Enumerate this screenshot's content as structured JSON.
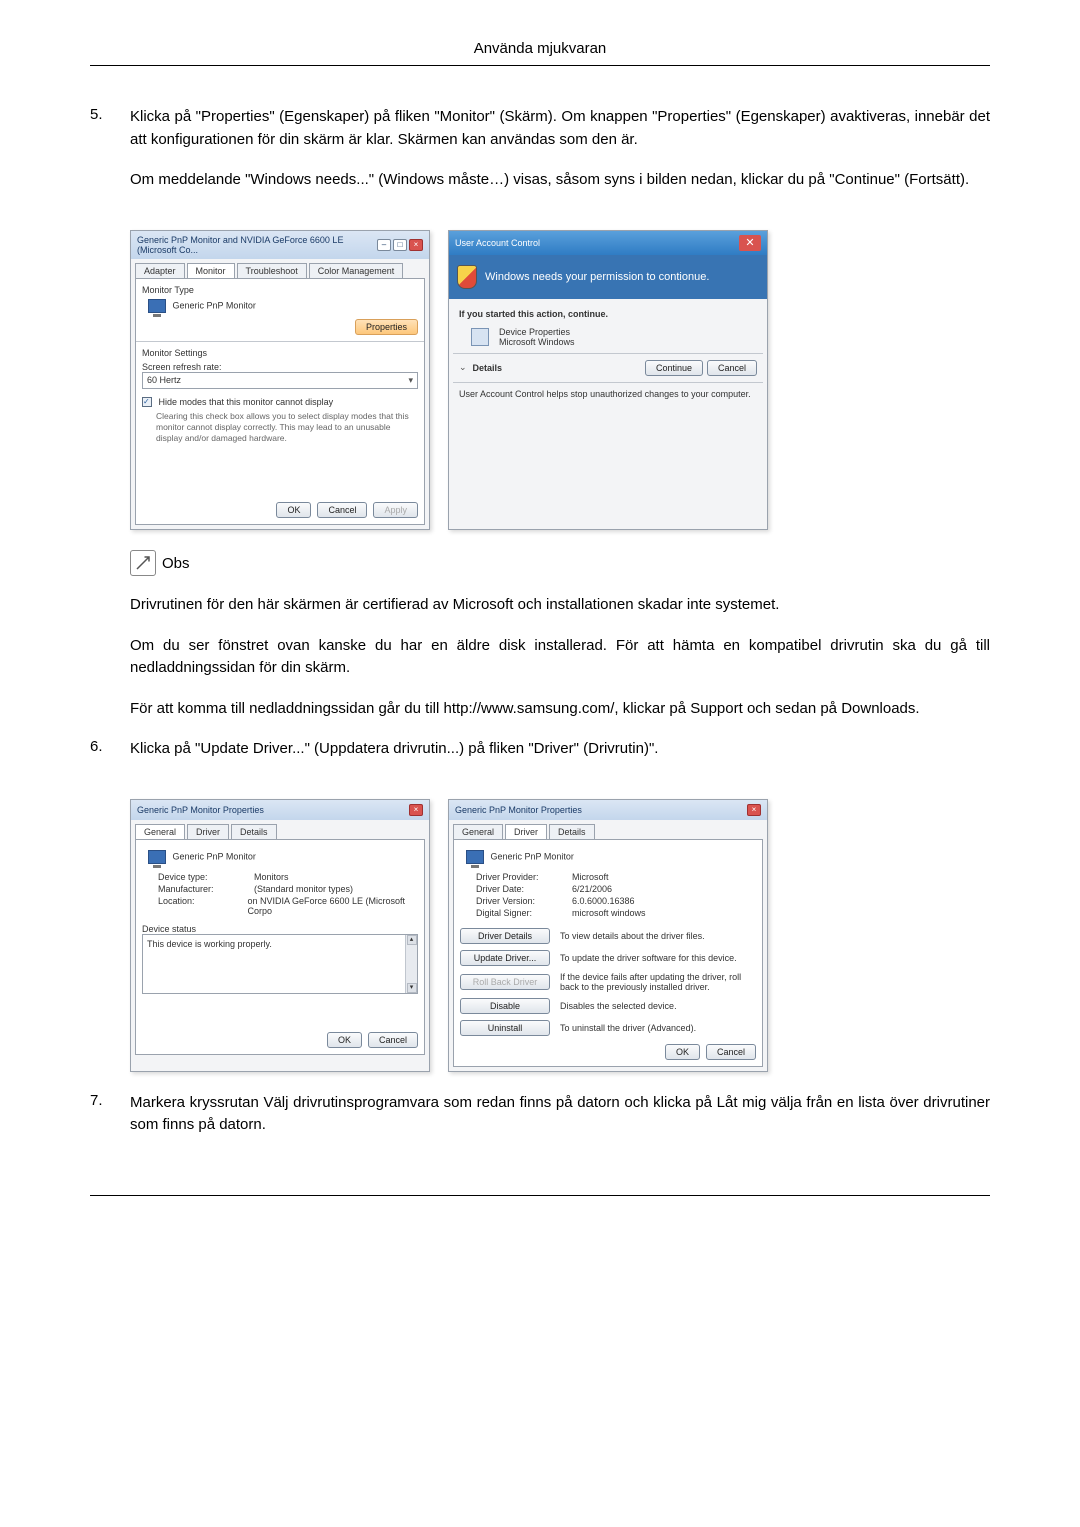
{
  "header": "Använda mjukvaran",
  "step5": {
    "num": "5.",
    "p1": "Klicka på \"Properties\" (Egenskaper) på fliken \"Monitor\" (Skärm). Om knappen \"Properties\" (Egenskaper) avaktiveras, innebär det att konfigurationen för din skärm är klar. Skärmen kan användas som den är.",
    "p2": "Om meddelande \"Windows needs...\" (Windows måste…) visas, såsom syns i bilden nedan, klickar du på \"Continue\" (Fortsätt)."
  },
  "shot1": {
    "title": "Generic PnP Monitor and NVIDIA GeForce 6600 LE (Microsoft Co...",
    "tabs": {
      "adapter": "Adapter",
      "monitor": "Monitor",
      "troubleshoot": "Troubleshoot",
      "color": "Color Management"
    },
    "monitorTypeLabel": "Monitor Type",
    "monitorName": "Generic PnP Monitor",
    "propertiesBtn": "Properties",
    "monitorSettingsLabel": "Monitor Settings",
    "refreshLabel": "Screen refresh rate:",
    "refreshValue": "60 Hertz",
    "hideCheck": "Hide modes that this monitor cannot display",
    "hideDesc": "Clearing this check box allows you to select display modes that this monitor cannot display correctly. This may lead to an unusable display and/or damaged hardware.",
    "ok": "OK",
    "cancel": "Cancel",
    "apply": "Apply"
  },
  "uac": {
    "title": "User Account Control",
    "headline": "Windows needs your permission to contionue.",
    "started": "If you started this action, continue.",
    "devProps": "Device Properties",
    "msWin": "Microsoft Windows",
    "details": "Details",
    "continue": "Continue",
    "cancel": "Cancel",
    "footer": "User Account Control helps stop unauthorized changes to your computer."
  },
  "obs": {
    "label": "Obs",
    "p1": "Drivrutinen för den här skärmen är certifierad av Microsoft och installationen skadar inte systemet.",
    "p2": "Om du ser fönstret ovan kanske du har en äldre disk installerad. För att hämta en kompatibel drivrutin ska du gå till nedladdningssidan för din skärm.",
    "p3": "För att komma till nedladdningssidan går du till http://www.samsung.com/, klickar på Support och sedan på Downloads."
  },
  "step6": {
    "num": "6.",
    "p1": "Klicka på \"Update Driver...\" (Uppdatera drivrutin...) på fliken \"Driver\" (Drivrutin)\"."
  },
  "shotGen": {
    "title": "Generic PnP Monitor Properties",
    "tabs": {
      "general": "General",
      "driver": "Driver",
      "details": "Details"
    },
    "monitorName": "Generic PnP Monitor",
    "devType": {
      "k": "Device type:",
      "v": "Monitors"
    },
    "manu": {
      "k": "Manufacturer:",
      "v": "(Standard monitor types)"
    },
    "loc": {
      "k": "Location:",
      "v": "on NVIDIA GeForce 6600 LE (Microsoft Corpo"
    },
    "statusLabel": "Device status",
    "statusText": "This device is working properly.",
    "ok": "OK",
    "cancel": "Cancel"
  },
  "shotDrv": {
    "title": "Generic PnP Monitor Properties",
    "tabs": {
      "general": "General",
      "driver": "Driver",
      "details": "Details"
    },
    "monitorName": "Generic PnP Monitor",
    "provider": {
      "k": "Driver Provider:",
      "v": "Microsoft"
    },
    "date": {
      "k": "Driver Date:",
      "v": "6/21/2006"
    },
    "version": {
      "k": "Driver Version:",
      "v": "6.0.6000.16386"
    },
    "signer": {
      "k": "Digital Signer:",
      "v": "microsoft windows"
    },
    "btnDetails": "Driver Details",
    "btnDetailsDesc": "To view details about the driver files.",
    "btnUpdate": "Update Driver...",
    "btnUpdateDesc": "To update the driver software for this device.",
    "btnRoll": "Roll Back Driver",
    "btnRollDesc": "If the device fails after updating the driver, roll back to the previously installed driver.",
    "btnDisable": "Disable",
    "btnDisableDesc": "Disables the selected device.",
    "btnUninstall": "Uninstall",
    "btnUninstallDesc": "To uninstall the driver (Advanced).",
    "ok": "OK",
    "cancel": "Cancel"
  },
  "step7": {
    "num": "7.",
    "p1": "Markera kryssrutan Välj drivrutinsprogramvara som redan finns på datorn och klicka på Låt mig välja från en lista över drivrutiner som finns på datorn."
  }
}
